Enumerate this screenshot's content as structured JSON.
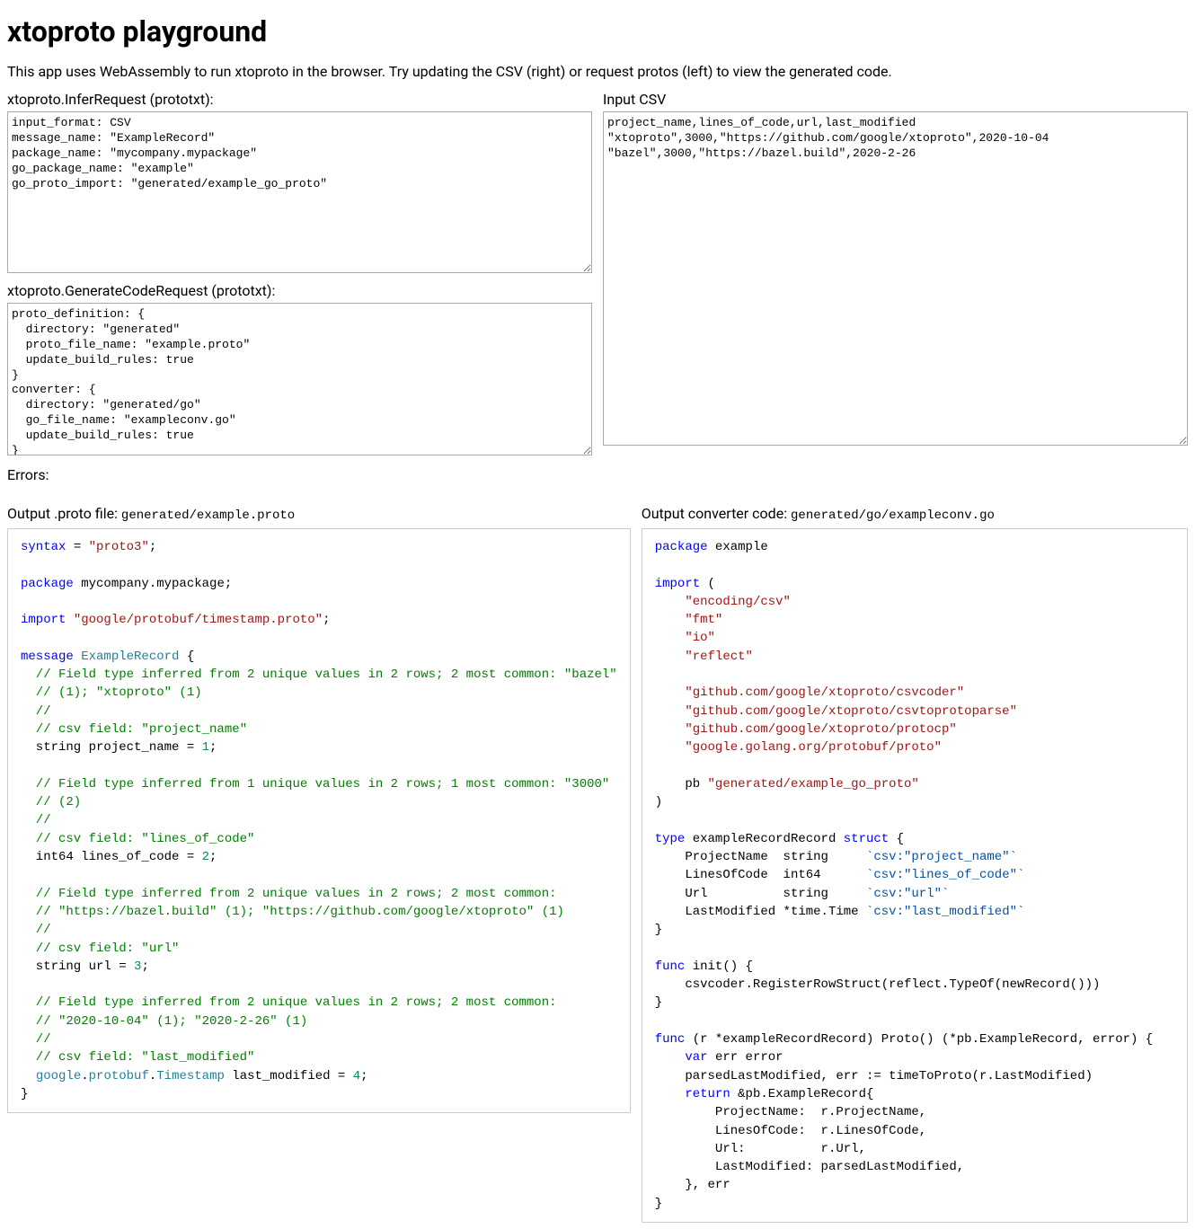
{
  "header": {
    "title": "xtoproto playground",
    "description": "This app uses WebAssembly to run xtoproto in the browser. Try updating the CSV (right) or request protos (left) to view the generated code."
  },
  "labels": {
    "inferRequest": "xtoproto.InferRequest (prototxt):",
    "generateCodeRequest": "xtoproto.GenerateCodeRequest (prototxt):",
    "inputCsv": "Input CSV",
    "errors": "Errors:",
    "outputProtoPrefix": "Output .proto file: ",
    "outputProtoPath": "generated/example.proto",
    "outputConverterPrefix": "Output converter code: ",
    "outputConverterPath": "generated/go/exampleconv.go"
  },
  "inputs": {
    "inferRequest": "input_format: CSV\nmessage_name: \"ExampleRecord\"\npackage_name: \"mycompany.mypackage\"\ngo_package_name: \"example\"\ngo_proto_import: \"generated/example_go_proto\"",
    "generateCodeRequest": "proto_definition: {\n  directory: \"generated\"\n  proto_file_name: \"example.proto\"\n  update_build_rules: true\n}\nconverter: {\n  directory: \"generated/go\"\n  go_file_name: \"exampleconv.go\"\n  update_build_rules: true\n}",
    "csv": "project_name,lines_of_code,url,last_modified\n\"xtoproto\",3000,\"https://github.com/google/xtoproto\",2020-10-04\n\"bazel\",3000,\"https://bazel.build\",2020-2-26"
  },
  "errorsText": "",
  "protoCode": {
    "syntax": "syntax",
    "eq": " = ",
    "proto3": "\"proto3\"",
    "semi": ";",
    "package": "package",
    "pkgName": " mycompany.mypackage;",
    "import": "import",
    "importPath": "\"google/protobuf/timestamp.proto\"",
    "message": "message",
    "msgName": "ExampleRecord",
    "openBrace": " {",
    "c1a": "  // Field type inferred from 2 unique values in 2 rows; 2 most common: \"bazel\"",
    "c1b": "  // (1); \"xtoproto\" (1)",
    "c1c": "  //",
    "c1d": "  // csv field: \"project_name\"",
    "f1": "  string project_name = ",
    "n1": "1",
    "c2a": "  // Field type inferred from 1 unique values in 2 rows; 1 most common: \"3000\"",
    "c2b": "  // (2)",
    "c2c": "  //",
    "c2d": "  // csv field: \"lines_of_code\"",
    "f2": "  int64 lines_of_code = ",
    "n2": "2",
    "c3a": "  // Field type inferred from 2 unique values in 2 rows; 2 most common:",
    "c3b": "  // \"https://bazel.build\" (1); \"https://github.com/google/xtoproto\" (1)",
    "c3c": "  //",
    "c3d": "  // csv field: \"url\"",
    "f3": "  string url = ",
    "n3": "3",
    "c4a": "  // Field type inferred from 2 unique values in 2 rows; 2 most common:",
    "c4b": "  // \"2020-10-04\" (1); \"2020-2-26\" (1)",
    "c4c": "  //",
    "c4d": "  // csv field: \"last_modified\"",
    "f4pre": "  ",
    "f4g": "google",
    "f4d1": ".",
    "f4p": "protobuf",
    "f4d2": ".",
    "f4t": "Timestamp",
    "f4rest": " last_modified = ",
    "n4": "4",
    "closeBrace": "}"
  },
  "goCode": {
    "package": "package",
    "pkgName": " example",
    "import": "import",
    "openParen": " (",
    "i1": "\"encoding/csv\"",
    "i2": "\"fmt\"",
    "i3": "\"io\"",
    "i4": "\"reflect\"",
    "i5": "\"github.com/google/xtoproto/csvcoder\"",
    "i6": "\"github.com/google/xtoproto/csvtoprotoparse\"",
    "i7": "\"github.com/google/xtoproto/protocp\"",
    "i8": "\"google.golang.org/protobuf/proto\"",
    "pbAlias": "    pb ",
    "pbPath": "\"generated/example_go_proto\"",
    "closeParen": ")",
    "type": "type",
    "typeName": " exampleRecordRecord ",
    "struct": "struct",
    "structOpen": " {",
    "s1name": "    ProjectName  string     ",
    "s1tag": "`csv:\"project_name\"`",
    "s2name": "    LinesOfCode  int64      ",
    "s2tag": "`csv:\"lines_of_code\"`",
    "s3name": "    Url          string     ",
    "s3tag": "`csv:\"url\"`",
    "s4name": "    LastModified *time.Time ",
    "s4tag": "`csv:\"last_modified\"`",
    "structClose": "}",
    "func": "func",
    "initSig": " init() {",
    "initBody": "    csvcoder.RegisterRowStruct(reflect.TypeOf(newRecord()))",
    "initClose": "}",
    "protoSig": " (r *exampleRecordRecord) Proto() (*pb.ExampleRecord, error) {",
    "var": "var",
    "varRest": " err error",
    "parseLine": "    parsedLastModified, err := timeToProto(r.LastModified)",
    "return": "return",
    "returnRest": " &pb.ExampleRecord{",
    "r1": "        ProjectName:  r.ProjectName,",
    "r2": "        LinesOfCode:  r.LinesOfCode,",
    "r3": "        Url:          r.Url,",
    "r4": "        LastModified: parsedLastModified,",
    "retClose": "    }, err",
    "funcClose": "}"
  }
}
